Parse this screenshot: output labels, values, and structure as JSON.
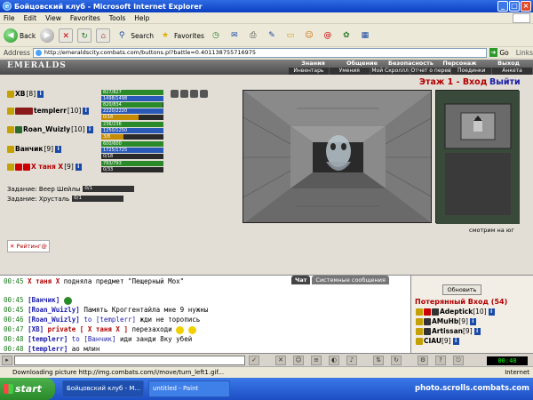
{
  "window": {
    "title": "Бойцовский клуб - Microsoft Internet Explorer"
  },
  "menu": [
    "File",
    "Edit",
    "View",
    "Favorites",
    "Tools",
    "Help"
  ],
  "toolbar": {
    "back": "Back",
    "search": "Search",
    "favorites": "Favorites"
  },
  "address": {
    "label": "Address",
    "url": "http://emeraldscity.combats.com/buttons.pl?battle=0.401138755716975",
    "go": "Go",
    "links": "Links"
  },
  "game": {
    "logo": "EMERALDS",
    "nav_top": [
      "Знания",
      "Общение",
      "Безопасность",
      "Персонаж",
      "Выход"
    ],
    "nav_bottom": [
      "Инвентарь",
      "Умения",
      "Мой Скроллл",
      "Отчет о переводах",
      "Поединки",
      "Анкета"
    ],
    "players": [
      {
        "name": "XB",
        "level": "[8]",
        "red": false,
        "bars": [
          "827/827",
          "1498/1498",
          "820/834",
          "2220/2220",
          "0/18"
        ]
      },
      {
        "name": "templerr",
        "level": "[10]",
        "red": false,
        "bars": []
      },
      {
        "name": "Roan_Wuizly",
        "level": "[10]",
        "red": false,
        "bars": [
          "236/236",
          "1250/1250",
          "3/8"
        ]
      },
      {
        "name": "Ванчик",
        "level": "[9]",
        "red": false,
        "bars": [
          "600/600",
          "1725/1725",
          "0/18"
        ]
      },
      {
        "name": "X таня X",
        "level": "[9]",
        "red": true,
        "bars": [
          "793/793",
          "0/33"
        ]
      }
    ],
    "tasks": [
      {
        "label": "Задание: Веер Шейлы",
        "progress": "0/1"
      },
      {
        "label": "Задание:    Хрусталь",
        "progress": "0/1"
      }
    ],
    "rating": "Рейтинг@",
    "location": "Этаж 1 - Вход",
    "exit_link": "Выйти",
    "watch_caption": "смотрим на юг"
  },
  "chat": {
    "tabs": [
      "Чат",
      "Системные сообщения"
    ],
    "lines": [
      {
        "time": "00:45",
        "sender": "X таня X",
        "red": true,
        "text": "подняла предмет \"Пещерный Мох\""
      },
      {
        "time": "00:45",
        "sender": "[Ванчик]",
        "red": false,
        "text": ""
      },
      {
        "time": "00:45",
        "sender": "[Roan_Wuizly]",
        "red": false,
        "text": "Память Кроггентайла мне 9 нужны"
      },
      {
        "time": "00:46",
        "sender": "[Roan_Wuizly]",
        "red": false,
        "to": "to [templerr]",
        "text": "жди не торопись"
      },
      {
        "time": "00:47",
        "sender": "[XB]",
        "red": false,
        "private": "private [ X таня X ]",
        "text": "перезаходи"
      },
      {
        "time": "00:48",
        "sender": "[templerr]",
        "red": false,
        "to": "to [Ванчик]",
        "text": "иди занди 8ку убей"
      },
      {
        "time": "00:48",
        "sender": "[templerr]",
        "red": false,
        "text": "ао млин"
      }
    ]
  },
  "room": {
    "refresh": "Обновить",
    "title": "Потерянный Вход (54)",
    "occupants": [
      {
        "name": "Adeptick",
        "level": "[10]"
      },
      {
        "name": "AMuHb",
        "level": "[9]"
      },
      {
        "name": "Artissan",
        "level": "[9]"
      },
      {
        "name": "CIAU",
        "level": "[9]"
      }
    ]
  },
  "clock": "00:48",
  "status": {
    "text": "Downloading picture http://img.combats.com/i/move/turn_left1.gif...",
    "zone": "Internet"
  },
  "taskbar": {
    "start": "start",
    "items": [
      "Бойцовский клуб - M...",
      "untitled - Paint"
    ],
    "tray_text": "photo.scrolls.combats.com"
  }
}
